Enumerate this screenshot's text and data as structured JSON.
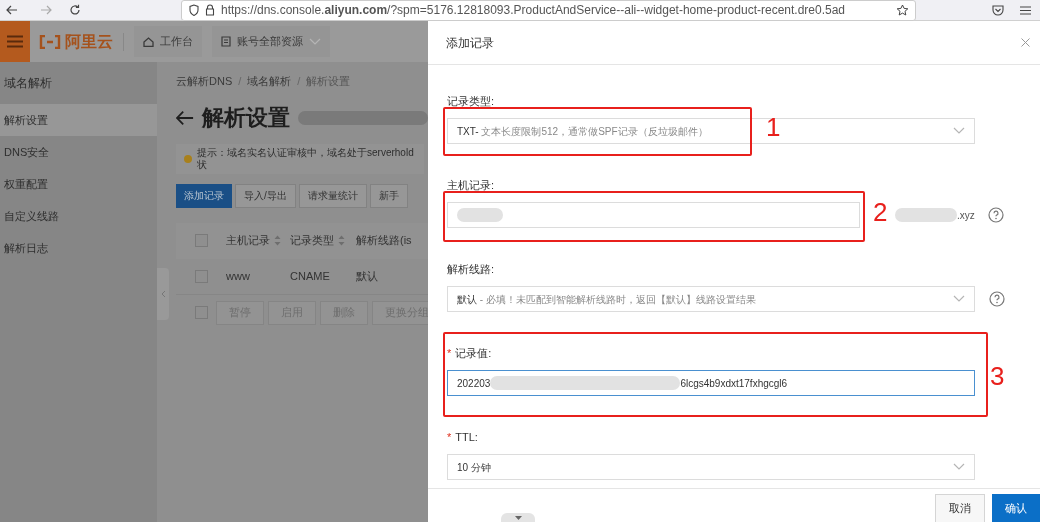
{
  "browser": {
    "url": "https://dns.console.**aliyun.com**/?spm=5176.12818093.ProductAndService--ali--widget-home-product-recent.dre0.5ad"
  },
  "header": {
    "logo": "阿里云",
    "nav": [
      {
        "label": "工作台",
        "kind": "home"
      },
      {
        "label": "账号全部资源",
        "kind": "resources"
      }
    ]
  },
  "sidebar": {
    "title": "域名解析",
    "items": [
      {
        "label": "解析设置",
        "selected": true
      },
      {
        "label": "DNS安全",
        "selected": false
      },
      {
        "label": "权重配置",
        "selected": false
      },
      {
        "label": "自定义线路",
        "selected": false
      },
      {
        "label": "解析日志",
        "selected": false
      }
    ]
  },
  "breadcrumb": {
    "separator": "/",
    "items": [
      "云解析DNS",
      "域名解析",
      "解析设置"
    ]
  },
  "page_title": "解析设置",
  "notice": "提示：域名实名认证审核中，域名处于serverhold状",
  "toolbar": [
    {
      "label": "添加记录",
      "primary": true
    },
    {
      "label": "导入/导出",
      "primary": false
    },
    {
      "label": "请求量统计",
      "primary": false
    },
    {
      "label": "新手",
      "primary": false
    }
  ],
  "table": {
    "header_checked": false,
    "columns": [
      "主机记录",
      "记录类型",
      "解析线路(is"
    ],
    "rows": [
      {
        "checked": false,
        "cells": [
          "www",
          "CNAME",
          "默认"
        ]
      }
    ],
    "batch_checked": false,
    "batch_actions": [
      "暂停",
      "启用",
      "删除",
      "更换分组"
    ]
  },
  "drawer": {
    "title": "添加记录",
    "fields": [
      {
        "kind": "select",
        "label": "记录类型:",
        "value": "TXT-",
        "hint": " 文本长度限制512，通常做SPF记录（反垃圾邮件）"
      },
      {
        "kind": "host",
        "label": "主机记录:",
        "suffix": ".xyz",
        "help": true
      },
      {
        "kind": "select",
        "label": "解析线路:",
        "value": "默认",
        "hint": " - 必填！未匹配到智能解析线路时，返回【默认】线路设置结果",
        "help": true
      },
      {
        "kind": "value",
        "required_mark": "*",
        "label": "记录值:",
        "value_start": "202203",
        "value_end": "6lcgs4b9xdxt17fxhgcgl6",
        "focused": true
      },
      {
        "kind": "select",
        "required_mark": "*",
        "label": "TTL:",
        "value": "10 分钟"
      }
    ],
    "buttons": [
      {
        "label": "取消",
        "primary": false
      },
      {
        "label": "确认",
        "primary": true
      }
    ]
  },
  "annotations": [
    "1",
    "2",
    "3"
  ]
}
